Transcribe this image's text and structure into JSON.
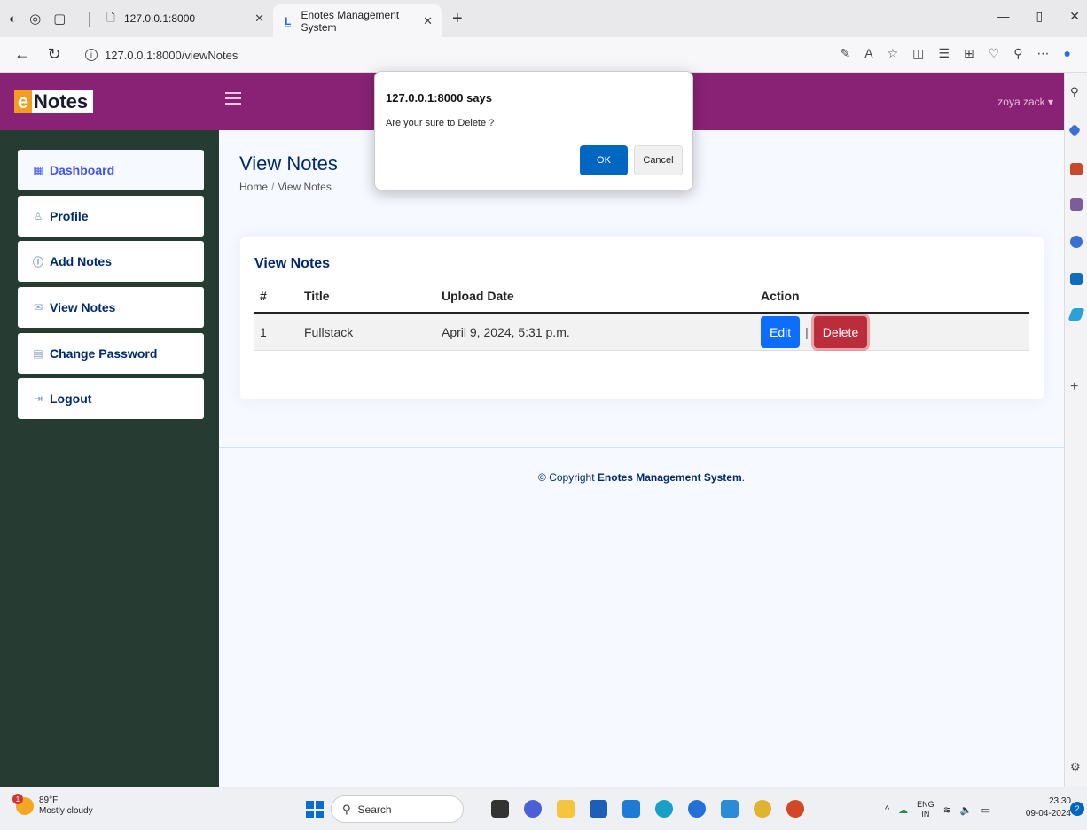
{
  "browser": {
    "tabs": [
      {
        "title": "127.0.0.1:8000"
      },
      {
        "title": "Enotes Management System"
      }
    ],
    "new_tab": "+",
    "address": "127.0.0.1:8000/viewNotes"
  },
  "header": {
    "logo_e": "e",
    "logo_rest": "Notes",
    "user": "zoya zack ▾"
  },
  "sidebar": {
    "items": [
      {
        "label": "Dashboard",
        "icon": "grid-icon"
      },
      {
        "label": "Profile",
        "icon": "person-icon"
      },
      {
        "label": "Add Notes",
        "icon": "question-icon"
      },
      {
        "label": "View Notes",
        "icon": "envelope-icon"
      },
      {
        "label": "Change Password",
        "icon": "card-icon"
      },
      {
        "label": "Logout",
        "icon": "logout-icon"
      }
    ]
  },
  "main": {
    "page_title": "View Notes",
    "breadcrumb": {
      "home": "Home",
      "sep": "/",
      "current": "View Notes"
    },
    "card_title": "View Notes",
    "table": {
      "headers": [
        "#",
        "Title",
        "Upload Date",
        "Action"
      ],
      "rows": [
        {
          "num": "1",
          "title": "Fullstack",
          "date": "April 9, 2024, 5:31 p.m.",
          "edit": "Edit",
          "sep": "|",
          "delete": "Delete"
        }
      ]
    },
    "footer": {
      "prefix": "© Copyright ",
      "brand": "Enotes Management System",
      "suffix": "."
    }
  },
  "dialog": {
    "title": "127.0.0.1:8000 says",
    "message": "Are your sure to Delete ?",
    "ok": "OK",
    "cancel": "Cancel"
  },
  "taskbar": {
    "weather_temp": "89°F",
    "weather_desc": "Mostly cloudy",
    "weather_badge": "1",
    "search": "Search",
    "lang_top": "ENG",
    "lang_bottom": "IN",
    "time": "23:30",
    "date": "09-04-2024",
    "notifications": "2"
  },
  "colors": {
    "header": "#892275",
    "sidebar": "#263b31",
    "primary": "#0d6efd",
    "danger": "#bb2d3b"
  }
}
